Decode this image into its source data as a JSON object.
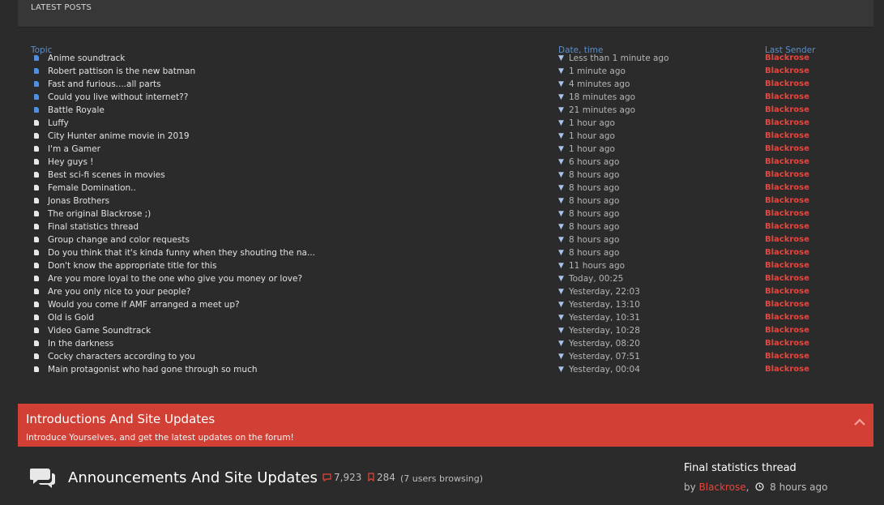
{
  "latest": {
    "heading": "LATEST POSTS",
    "col_topic": "Topic",
    "col_date": "Date, time",
    "col_sender": "Last Sender",
    "rows": [
      {
        "topic": "Anime soundtrack",
        "time": "Less than 1 minute ago",
        "sender": "Blackrose",
        "new": true
      },
      {
        "topic": "Robert pattison is the new batman",
        "time": "1 minute ago",
        "sender": "Blackrose",
        "new": true
      },
      {
        "topic": "Fast and furious....all parts",
        "time": "4 minutes ago",
        "sender": "Blackrose",
        "new": true
      },
      {
        "topic": "Could you live without internet??",
        "time": "18 minutes ago",
        "sender": "Blackrose",
        "new": true
      },
      {
        "topic": "Battle Royale",
        "time": "21 minutes ago",
        "sender": "Blackrose",
        "new": true
      },
      {
        "topic": "Luffy",
        "time": "1 hour ago",
        "sender": "Blackrose",
        "new": false
      },
      {
        "topic": "City Hunter anime movie in 2019",
        "time": "1 hour ago",
        "sender": "Blackrose",
        "new": false
      },
      {
        "topic": "I'm a Gamer",
        "time": "1 hour ago",
        "sender": "Blackrose",
        "new": false
      },
      {
        "topic": "Hey guys !",
        "time": "6 hours ago",
        "sender": "Blackrose",
        "new": false
      },
      {
        "topic": "Best sci-fi scenes in movies",
        "time": "8 hours ago",
        "sender": "Blackrose",
        "new": false
      },
      {
        "topic": "Female Domination..",
        "time": "8 hours ago",
        "sender": "Blackrose",
        "new": false
      },
      {
        "topic": "Jonas Brothers",
        "time": "8 hours ago",
        "sender": "Blackrose",
        "new": false
      },
      {
        "topic": "The original Blackrose ;)",
        "time": "8 hours ago",
        "sender": "Blackrose",
        "new": false
      },
      {
        "topic": "Final statistics thread",
        "time": "8 hours ago",
        "sender": "Blackrose",
        "new": false
      },
      {
        "topic": "Group change and color requests",
        "time": "8 hours ago",
        "sender": "Blackrose",
        "new": false
      },
      {
        "topic": "Do you think that it's kinda funny when they shouting the na...",
        "time": "8 hours ago",
        "sender": "Blackrose",
        "new": false
      },
      {
        "topic": "Don't know the appropriate title for this",
        "time": "11 hours ago",
        "sender": "Blackrose",
        "new": false
      },
      {
        "topic": "Are you more loyal to the one who give you money or love?",
        "time": "Today, 00:25",
        "sender": "Blackrose",
        "new": false
      },
      {
        "topic": "Are you only nice to your people?",
        "time": "Yesterday, 22:03",
        "sender": "Blackrose",
        "new": false
      },
      {
        "topic": "Would you come if AMF arranged a meet up?",
        "time": "Yesterday, 13:10",
        "sender": "Blackrose",
        "new": false
      },
      {
        "topic": "Old is Gold",
        "time": "Yesterday, 10:31",
        "sender": "Blackrose",
        "new": false
      },
      {
        "topic": "Video Game Soundtrack",
        "time": "Yesterday, 10:28",
        "sender": "Blackrose",
        "new": false
      },
      {
        "topic": "In the darkness",
        "time": "Yesterday, 08:20",
        "sender": "Blackrose",
        "new": false
      },
      {
        "topic": "Cocky characters according to you",
        "time": "Yesterday, 07:51",
        "sender": "Blackrose",
        "new": false
      },
      {
        "topic": "Main protagonist who had gone through so much",
        "time": "Yesterday, 00:04",
        "sender": "Blackrose",
        "new": false
      }
    ]
  },
  "category": {
    "title": "Introductions And Site Updates",
    "description": "Introduce Yourselves, and get the latest updates on the forum!"
  },
  "forum": {
    "title": "Announcements And Site Updates",
    "posts": "7,923",
    "topics": "284",
    "browsing": "(7 users browsing)",
    "last_post_title": "Final statistics thread",
    "by_label": "by",
    "last_post_user": "Blackrose",
    "last_post_time": "8 hours ago"
  },
  "colors": {
    "accent_red": "#d23f34",
    "link_blue": "#5b8fc9",
    "sender_red": "#e8453c",
    "background": "#2b2b2b"
  }
}
